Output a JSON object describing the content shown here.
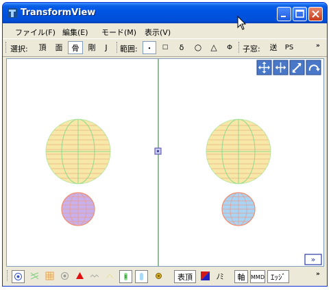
{
  "window": {
    "title": "TransformView"
  },
  "menu": [
    "ファイル(F)",
    "編集(E)",
    "モード(M)",
    "表示(V)"
  ],
  "toolbar": {
    "select_label": "選択:",
    "vertex": "頂",
    "face": "面",
    "bone": "骨",
    "rigid": "剛",
    "joint": "J",
    "range_label": "範囲:",
    "range_point": "・",
    "range_square": "□",
    "range_delta": "δ",
    "range_circle": "○",
    "range_triangle": "△",
    "range_phi": "Φ",
    "child_label": "子窓:",
    "send": "送",
    "ps": "PS",
    "more": "»"
  },
  "bottom_toolbar": {
    "surface_button": "表頂",
    "lock_button": "ﾉﾐ",
    "axis_button": "軸",
    "mmd_button": "MMD",
    "edge_button": "ｴｯｼﾞ",
    "more": "»"
  },
  "viewport": {
    "expand_button": "»"
  },
  "colors": {
    "big_sphere_fill": "#f7e8a8",
    "big_sphere_lines": "#8fd88f",
    "small_sphere_left": "#c9b0ea",
    "small_sphere_right": "#aad4f4",
    "small_sphere_outline": "#f08a6a",
    "axis_line": "#2a7a2a"
  }
}
